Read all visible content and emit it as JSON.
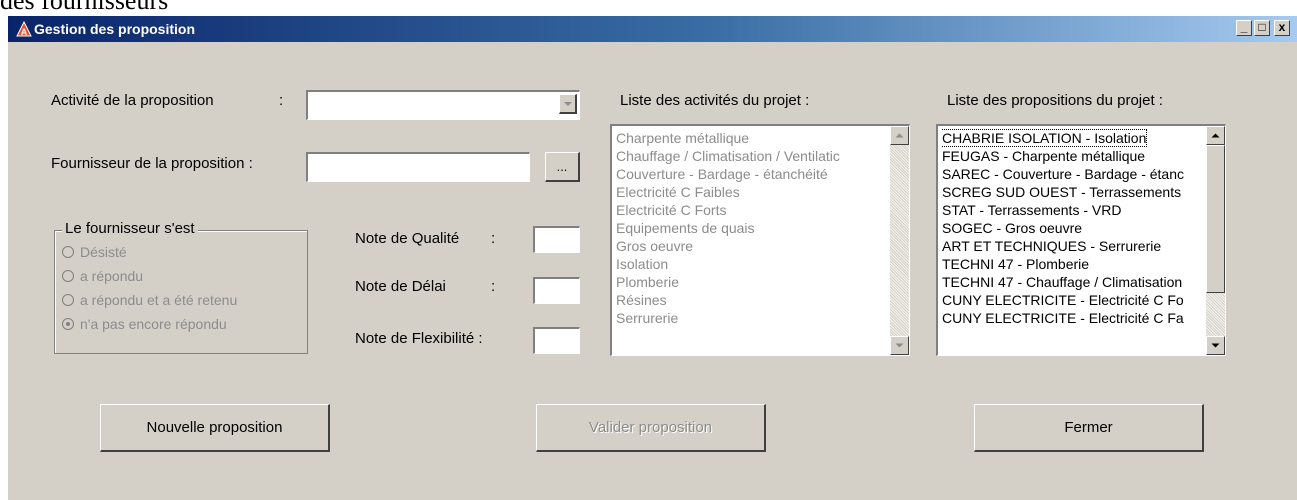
{
  "document": {
    "fragment_text": "des fournisseurs"
  },
  "window": {
    "title": "Gestion des proposition",
    "icon": "warning-a-icon",
    "controls": {
      "minimize": "_",
      "maximize": "□",
      "close": "x"
    }
  },
  "form": {
    "activity_label": "Activité de la proposition",
    "activity_colon": ":",
    "activity_value": "",
    "supplier_label": "Fournisseur de la proposition :",
    "supplier_value": "",
    "browse_label": "...",
    "status_group": {
      "caption": "Le fournisseur s'est",
      "options": [
        {
          "label": "Désisté",
          "checked": false
        },
        {
          "label": "a répondu",
          "checked": false
        },
        {
          "label": "a répondu et a été retenu",
          "checked": false
        },
        {
          "label": "n'a pas encore répondu",
          "checked": true
        }
      ]
    },
    "notes": {
      "quality_label": "Note de Qualité",
      "quality_colon": ":",
      "quality_value": "",
      "delay_label": "Note de Délai",
      "delay_colon": ":",
      "delay_value": "",
      "flexibility_label": "Note de Flexibilité :",
      "flexibility_value": ""
    }
  },
  "activities_list": {
    "header": "Liste des activités du projet :",
    "items": [
      "Charpente métallique",
      "Chauffage / Climatisation / Ventilatic",
      "Couverture - Bardage - étanchéité",
      "Electricité C Faibles",
      "Electricité C Forts",
      "Equipements de quais",
      "Gros oeuvre",
      "Isolation",
      "Plomberie",
      "Résines",
      "Serrurerie"
    ]
  },
  "propositions_list": {
    "header": "Liste des propositions du projet :",
    "items": [
      "CHABRIE ISOLATION - Isolation",
      "FEUGAS - Charpente métallique",
      "SAREC - Couverture - Bardage - étanc",
      "SCREG SUD OUEST - Terrassements",
      "STAT - Terrassements - VRD",
      "SOGEC - Gros oeuvre",
      "ART ET TECHNIQUES - Serrurerie",
      "TECHNI 47 - Plomberie",
      "TECHNI 47 - Chauffage / Climatisation",
      "CUNY ELECTRICITE - Electricité C Fo",
      "CUNY ELECTRICITE - Electricité C Fa"
    ]
  },
  "buttons": {
    "new": "Nouvelle proposition",
    "validate": "Valider proposition",
    "close": "Fermer"
  },
  "icons": [
    "warning-a-icon",
    "combo-arrow-icon",
    "scroll-up-icon",
    "scroll-down-icon"
  ]
}
